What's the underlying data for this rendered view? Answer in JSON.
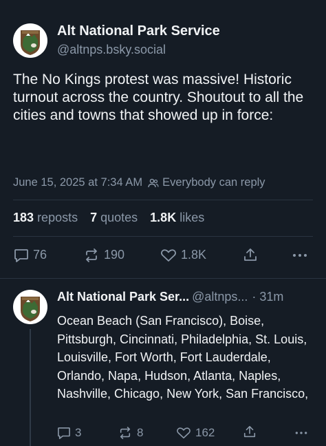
{
  "post": {
    "author_name": "Alt National Park Service",
    "author_handle": "@altnps.bsky.social",
    "text": "The No Kings protest was massive! Historic turnout across the country. Shoutout to all the cities and towns that showed up in force:",
    "timestamp": "June 15, 2025 at 7:34 AM",
    "reply_setting": "Everybody can reply",
    "stats": {
      "reposts_count": "183",
      "reposts_label": "reposts",
      "quotes_count": "7",
      "quotes_label": "quotes",
      "likes_count": "1.8K",
      "likes_label": "likes"
    },
    "actions": {
      "replies": "76",
      "reposts": "190",
      "likes": "1.8K"
    }
  },
  "reply": {
    "author_name": "Alt National Park Ser...",
    "author_handle": "@altnps...",
    "age": "· 31m",
    "text": "Ocean Beach (San Francisco), Boise, Pittsburgh, Cincinnati, Philadelphia, St. Louis, Louisville, Fort Worth, Fort Lauderdale, Orlando, Napa, Hudson, Atlanta, Naples, Nashville, Chicago, New York, San Francisco,",
    "actions": {
      "replies": "3",
      "reposts": "8",
      "likes": "162"
    }
  },
  "colors": {
    "background": "#151c25",
    "text": "#f1f3f5",
    "muted": "#8b98a8",
    "divider": "#2a3441",
    "avatar_brown": "#6b4a2b",
    "avatar_green": "#3d6b35"
  },
  "icons": [
    "reply-icon",
    "repost-icon",
    "like-icon",
    "share-icon",
    "more-icon",
    "people-icon"
  ]
}
